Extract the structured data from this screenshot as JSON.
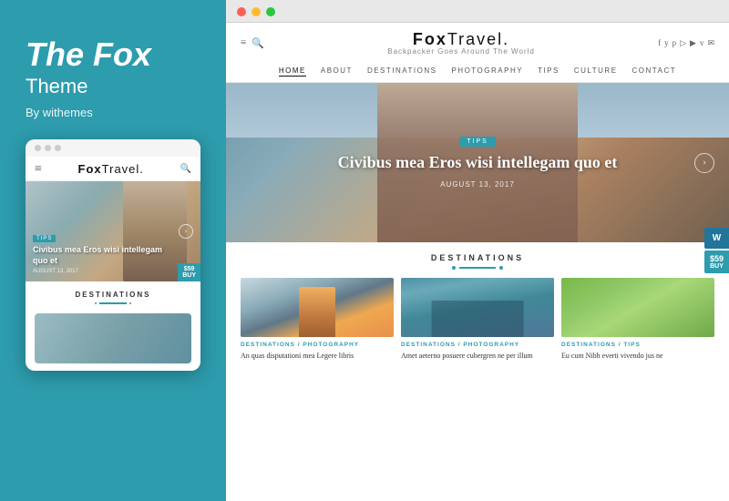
{
  "left": {
    "title": "The Fox",
    "subtitle": "Theme",
    "author": "By withemes",
    "phone": {
      "dots": [
        "dot1",
        "dot2",
        "dot3"
      ],
      "logo": "FoxTravel.",
      "hero_tag": "TIPS",
      "hero_title": "Civibus mea Eros wisi intellegam quo et",
      "hero_date": "AUGUST 13, 2017",
      "arrow": "›",
      "price": "$59",
      "buy": "BUY",
      "destinations_label": "DESTINATIONS"
    }
  },
  "browser": {
    "dots": [
      "red",
      "yellow",
      "green"
    ]
  },
  "site": {
    "logo": "FoxTravel.",
    "tagline": "Backpacker Goes Around The World",
    "nav": [
      "HOME",
      "ABOUT",
      "DESTINATIONS",
      "PHOTOGRAPHY",
      "TIPS",
      "CULTURE",
      "CONTACT"
    ],
    "active_nav": "HOME",
    "hero": {
      "tag": "TIPS",
      "title": "Civibus mea Eros wisi intellegam quo et",
      "date": "AUGUST 13, 2017",
      "arrow": "›"
    },
    "destinations": {
      "section_title": "DESTINATIONS",
      "cards": [
        {
          "tag": "DESTINATIONS / PHOTOGRAPHY",
          "text": "An quas disputationi mea Legere libris"
        },
        {
          "tag": "DESTINATIONS / PHOTOGRAPHY",
          "text": "Amet aeterno posuere cubergren ne per illum"
        },
        {
          "tag": "DESTINATIONS / TIPS",
          "text": "Eu cum Nibh everti vivendo jus ne"
        }
      ]
    },
    "social_icons": [
      "f",
      "y",
      "p",
      "▷",
      "▶",
      "v",
      "✉"
    ],
    "wp_badge": "W",
    "price_badge": "$59",
    "buy_label": "BUY"
  }
}
